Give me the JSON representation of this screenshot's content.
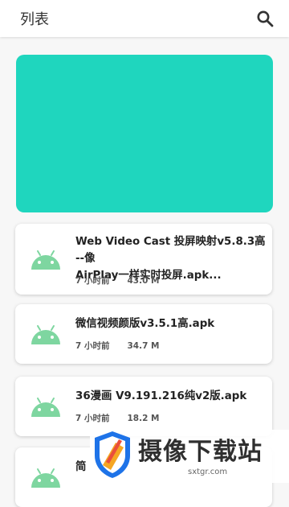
{
  "appbar": {
    "title": "列表",
    "search_icon": "search-icon"
  },
  "banner": {
    "color": "#1fd6be"
  },
  "items": [
    {
      "name": "Web Video Cast 投屏映射v5.8.3高 --像\nAirPlay一样实时投屏.apk...",
      "time": "7 小时前",
      "size": "43.0 M"
    },
    {
      "name": "微信视频颜版v3.5.1高.apk",
      "time": "7 小时前",
      "size": "34.7 M"
    },
    {
      "name": "36漫画 V9.191.216纯v2版.apk",
      "time": "7 小时前",
      "size": "18.2 M"
    },
    {
      "name": "简",
      "time": "",
      "size": ""
    }
  ],
  "watermark": {
    "title": "摄像下载站",
    "url": "sxtgr.com"
  },
  "colors": {
    "android": "#7ed6a0",
    "accent": "#1fd6be"
  }
}
